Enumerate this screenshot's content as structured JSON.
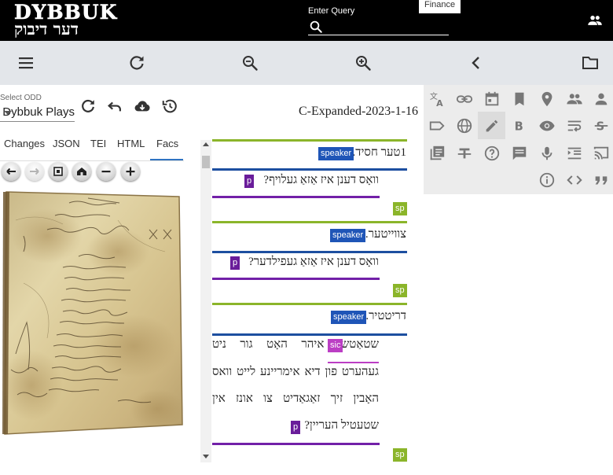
{
  "header": {
    "logo_latin": "DYBBUK",
    "logo_hebrew": "דער דיבוק",
    "query_label": "Enter Query",
    "finance_chip": "Finance"
  },
  "left_panel": {
    "odd_label": "Select ODD",
    "odd_value": "Dybbuk Plays",
    "tabs": [
      "Changes",
      "JSON",
      "TEI",
      "HTML",
      "Facs"
    ],
    "active_tab": "Facs"
  },
  "document": {
    "title": "C-Expanded-2023-1-16",
    "speaker_tag": "speaker",
    "p_tag": "p",
    "sp_tag": "sp",
    "sic_tag": "sic",
    "blocks": [
      {
        "speaker": "1טער חסיד.",
        "lines": [
          "וואָס דענן איז אַזאַ געלויף?"
        ]
      },
      {
        "speaker": "צווייטער.",
        "lines": [
          "וואָס דענן איז אַזאַ געפילדער?"
        ]
      },
      {
        "speaker": "דריטטיר.",
        "lines": [
          "שטאַטש. איהר האָט גור ניט",
          "געהערט פון דיא אימריינע לייט וואס",
          "האָבין זיך זאַגאַדיט צו אונז אין",
          "שטעטיל העריין?"
        ]
      }
    ]
  },
  "colors": {
    "header_bg": "#000000",
    "toolbar_bg": "#e3e6ea",
    "speaker": "#1f55b7",
    "p": "#6a1d9a",
    "sp": "#8bb52a",
    "sic": "#bb3ec4",
    "active_tab_underline": "#2f73c2"
  }
}
